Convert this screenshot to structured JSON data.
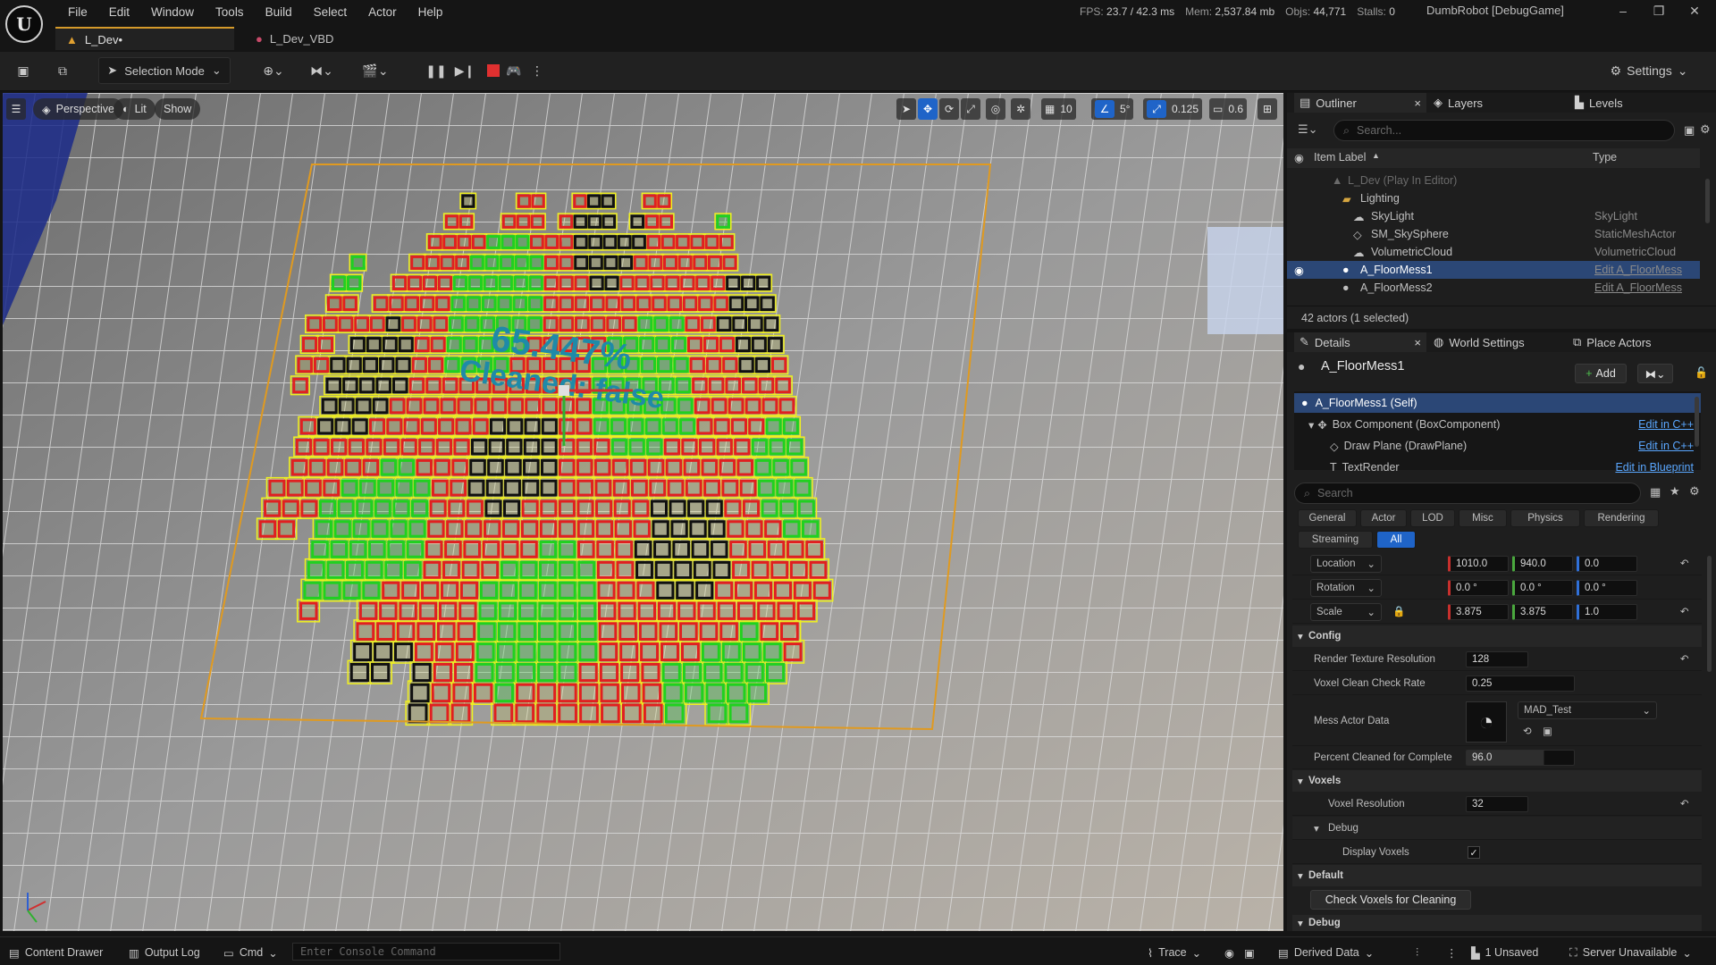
{
  "menu": [
    "File",
    "Edit",
    "Window",
    "Tools",
    "Build",
    "Select",
    "Actor",
    "Help"
  ],
  "stats": {
    "fps_label": "FPS:",
    "fps": "23.7",
    "ms": "/ 42.3 ms",
    "mem_label": "Mem:",
    "mem": "2,537.84 mb",
    "objs_label": "Objs:",
    "objs": "44,771",
    "stalls_label": "Stalls:",
    "stalls": "0"
  },
  "project": "DumbRobot [DebugGame]",
  "tabs": [
    {
      "label": "L_Dev•"
    },
    {
      "label": "L_Dev_VBD"
    }
  ],
  "toolbar": {
    "selection_mode": "Selection Mode",
    "settings": "Settings"
  },
  "viewport": {
    "perspective": "Perspective",
    "lit": "Lit",
    "show": "Show",
    "grid_size": "10",
    "rot_snap": "5°",
    "scale_snap": "0.125",
    "cam_speed": "0.6",
    "overlay_percent": "65.447%",
    "overlay_cleaned": "Cleaned: false"
  },
  "outliner": {
    "tab_outliner": "Outliner",
    "tab_layers": "Layers",
    "tab_levels": "Levels",
    "search_placeholder": "Search...",
    "col_label": "Item Label",
    "col_type": "Type",
    "rows": [
      {
        "label": "L_Dev (Play In Editor)",
        "type": ""
      },
      {
        "label": "Lighting",
        "type": ""
      },
      {
        "label": "SkyLight",
        "type": "SkyLight"
      },
      {
        "label": "SM_SkySphere",
        "type": "StaticMeshActor"
      },
      {
        "label": "VolumetricCloud",
        "type": "VolumetricCloud"
      },
      {
        "label": "A_FloorMess1",
        "type": "Edit A_FloorMess"
      },
      {
        "label": "A_FloorMess2",
        "type": "Edit A_FloorMess"
      }
    ],
    "footer": "42 actors (1 selected)"
  },
  "details": {
    "tab_details": "Details",
    "tab_world": "World Settings",
    "tab_place": "Place Actors",
    "actor_name": "A_FloorMess1",
    "add": "Add",
    "components": [
      {
        "label": "A_FloorMess1 (Self)",
        "edit": ""
      },
      {
        "label": "Box Component (BoxComponent)",
        "edit": "Edit in C++"
      },
      {
        "label": "Draw Plane (DrawPlane)",
        "edit": "Edit in C++"
      },
      {
        "label": "TextRender",
        "edit": "Edit in Blueprint"
      }
    ],
    "search_placeholder": "Search",
    "categories": [
      "General",
      "Actor",
      "LOD",
      "Misc",
      "Physics",
      "Rendering",
      "Streaming",
      "All"
    ],
    "transform": {
      "location_label": "Location",
      "location": [
        "1010.0",
        "940.0",
        "0.0"
      ],
      "rotation_label": "Rotation",
      "rotation": [
        "0.0 °",
        "0.0 °",
        "0.0 °"
      ],
      "scale_label": "Scale",
      "scale": [
        "3.875",
        "3.875",
        "1.0"
      ]
    },
    "config_header": "Config",
    "render_texture_resolution_label": "Render Texture Resolution",
    "render_texture_resolution": "128",
    "voxel_clean_check_rate_label": "Voxel Clean Check Rate",
    "voxel_clean_check_rate": "0.25",
    "mess_actor_data_label": "Mess Actor Data",
    "mess_actor_data": "MAD_Test",
    "percent_cleaned_label": "Percent Cleaned for Complete",
    "percent_cleaned": "96.0",
    "voxels_header": "Voxels",
    "voxel_resolution_label": "Voxel Resolution",
    "voxel_resolution": "32",
    "debug_header": "Debug",
    "display_voxels_label": "Display Voxels",
    "display_voxels": true,
    "default_header": "Default",
    "check_voxels_button": "Check Voxels for Cleaning",
    "debug_header2": "Debug"
  },
  "statusbar": {
    "content_drawer": "Content Drawer",
    "output_log": "Output Log",
    "cmd": "Cmd",
    "console_placeholder": "Enter Console Command",
    "trace": "Trace",
    "derived_data": "Derived Data",
    "unsaved": "1 Unsaved",
    "server": "Server Unavailable"
  }
}
